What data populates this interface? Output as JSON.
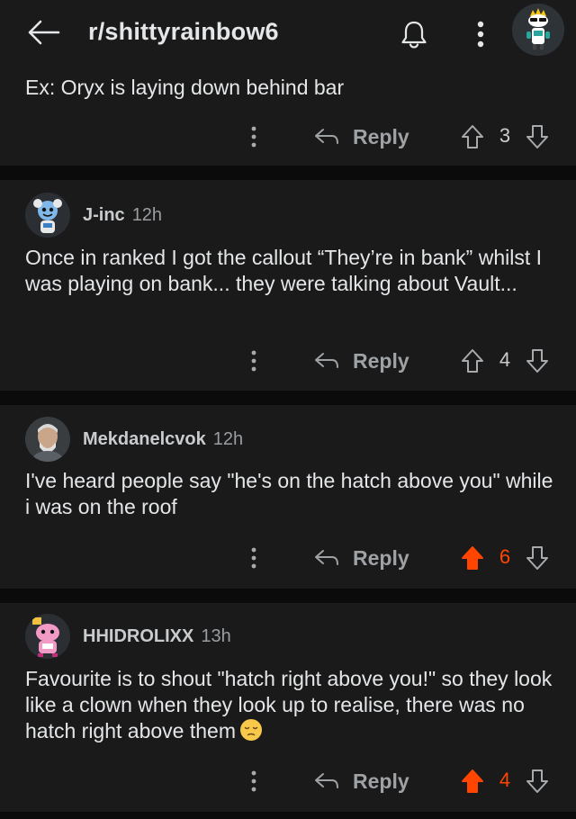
{
  "header": {
    "title": "r/shittyrainbow6",
    "back_icon": "arrow-left-icon",
    "bell_icon": "bell-icon",
    "more_icon": "more-vertical-icon"
  },
  "colors": {
    "background": "#0b0b0b",
    "card": "#1a1a1b",
    "text": "#e4e6e8",
    "muted": "#9fa2a5",
    "upvote_active": "#ff4500"
  },
  "comments": [
    {
      "text": "Ex: Oryx is laying down behind bar",
      "reply_label": "Reply",
      "score": "3",
      "upvoted": false
    },
    {
      "author": "J-inc",
      "time": "12h",
      "text": "Once in ranked I got the callout “They’re in bank” whilst I was playing on bank... they were talking about Vault...",
      "reply_label": "Reply",
      "score": "4",
      "upvoted": false
    },
    {
      "author": "Mekdanelcvok",
      "time": "12h",
      "text": "I've heard people say \"he's on the hatch above you\" while i was on the roof",
      "reply_label": "Reply",
      "score": "6",
      "upvoted": true
    },
    {
      "author": "HHIDROLIXX",
      "time": "13h",
      "text": "Favourite is to shout \"hatch right above you!\" so they look like a clown when they look up to realise, there was no hatch right above them",
      "emoji": "pensive-face-emoji",
      "reply_label": "Reply",
      "score": "4",
      "upvoted": true
    }
  ]
}
